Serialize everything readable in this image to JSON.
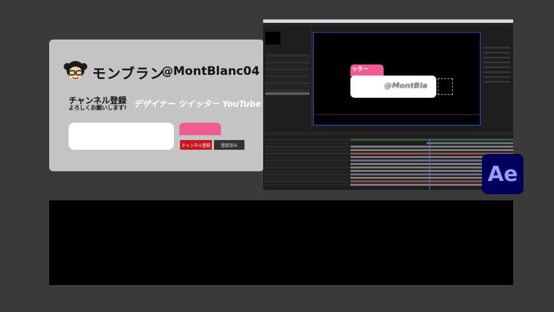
{
  "card": {
    "brand_name": "モンブラン",
    "handle": "@MontBlanc04",
    "subtitle": "チャンネル登録",
    "subtitle_desc": "よろしくお願いします!",
    "tagline": "デザイナー ツイッター YouTube",
    "subscribe_label": "チャンネル登録",
    "subscribed_label": "登録済み",
    "accent_pink": "#ef5c91",
    "subscribe_red": "#c4161c"
  },
  "ae": {
    "preview_tab_text": "ッター",
    "preview_text": "@MontBla",
    "badge": "Ae",
    "badge_bg": "#00005b",
    "badge_fg": "#9999ff"
  }
}
